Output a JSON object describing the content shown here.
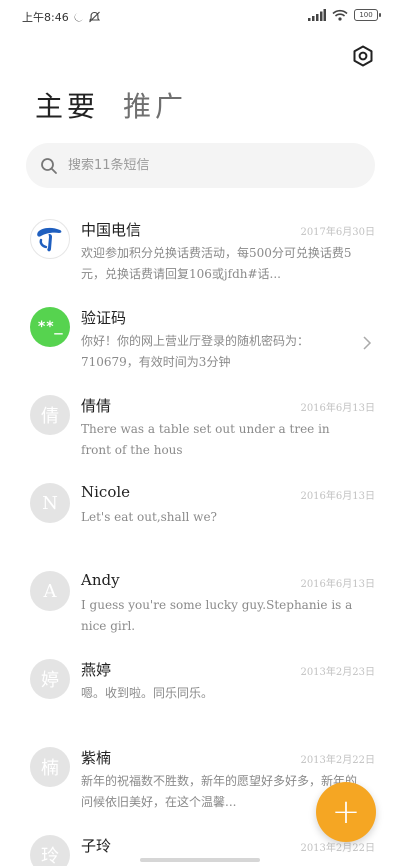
{
  "status_bar": {
    "time": "上午8:46",
    "battery": "100"
  },
  "tabs": [
    {
      "label": "主要",
      "active": true
    },
    {
      "label": "推广",
      "active": false
    }
  ],
  "search": {
    "placeholder": "搜索11条短信"
  },
  "conversations": [
    {
      "name": "中国电信",
      "time": "2017年6月30日",
      "preview": "欢迎参加积分兑换话费活动，每500分可兑换话费5元，兑换话费请回复106或jfdh#话...",
      "avatar_type": "china-telecom-logo"
    },
    {
      "name": "验证码",
      "time": "",
      "preview": "你好！你的网上营业厅登录的随机密码为：710679，有效时间为3分钟",
      "avatar_text": "**_",
      "avatar_color": "#56d34f"
    },
    {
      "name": "倩倩",
      "time": "2016年6月13日",
      "preview": "There was a table set out under a tree in front of the hous",
      "avatar_text": "倩"
    },
    {
      "name": "Nicole",
      "time": "2016年6月13日",
      "preview": "Let's eat out,shall we?",
      "avatar_text": "N"
    },
    {
      "name": "Andy",
      "time": "2016年6月13日",
      "preview": "I guess you're some lucky guy.Stephanie is a nice girl.",
      "avatar_text": "A"
    },
    {
      "name": "燕婷",
      "time": "2013年2月23日",
      "preview": "嗯。收到啦。同乐同乐。",
      "avatar_text": "婷"
    },
    {
      "name": "紫楠",
      "time": "2013年2月22日",
      "preview": "新年的祝福数不胜数，新年的愿望好多好多，新年的问候依旧美好，在这个温馨...",
      "avatar_text": "楠"
    },
    {
      "name": "子玲",
      "time": "2013年2月22日",
      "preview": "",
      "avatar_text": "玲"
    }
  ],
  "fab": {
    "label": "+"
  },
  "colors": {
    "accent": "#f5a623",
    "verify_green": "#56d34f",
    "telecom_blue": "#1f5fbf"
  }
}
